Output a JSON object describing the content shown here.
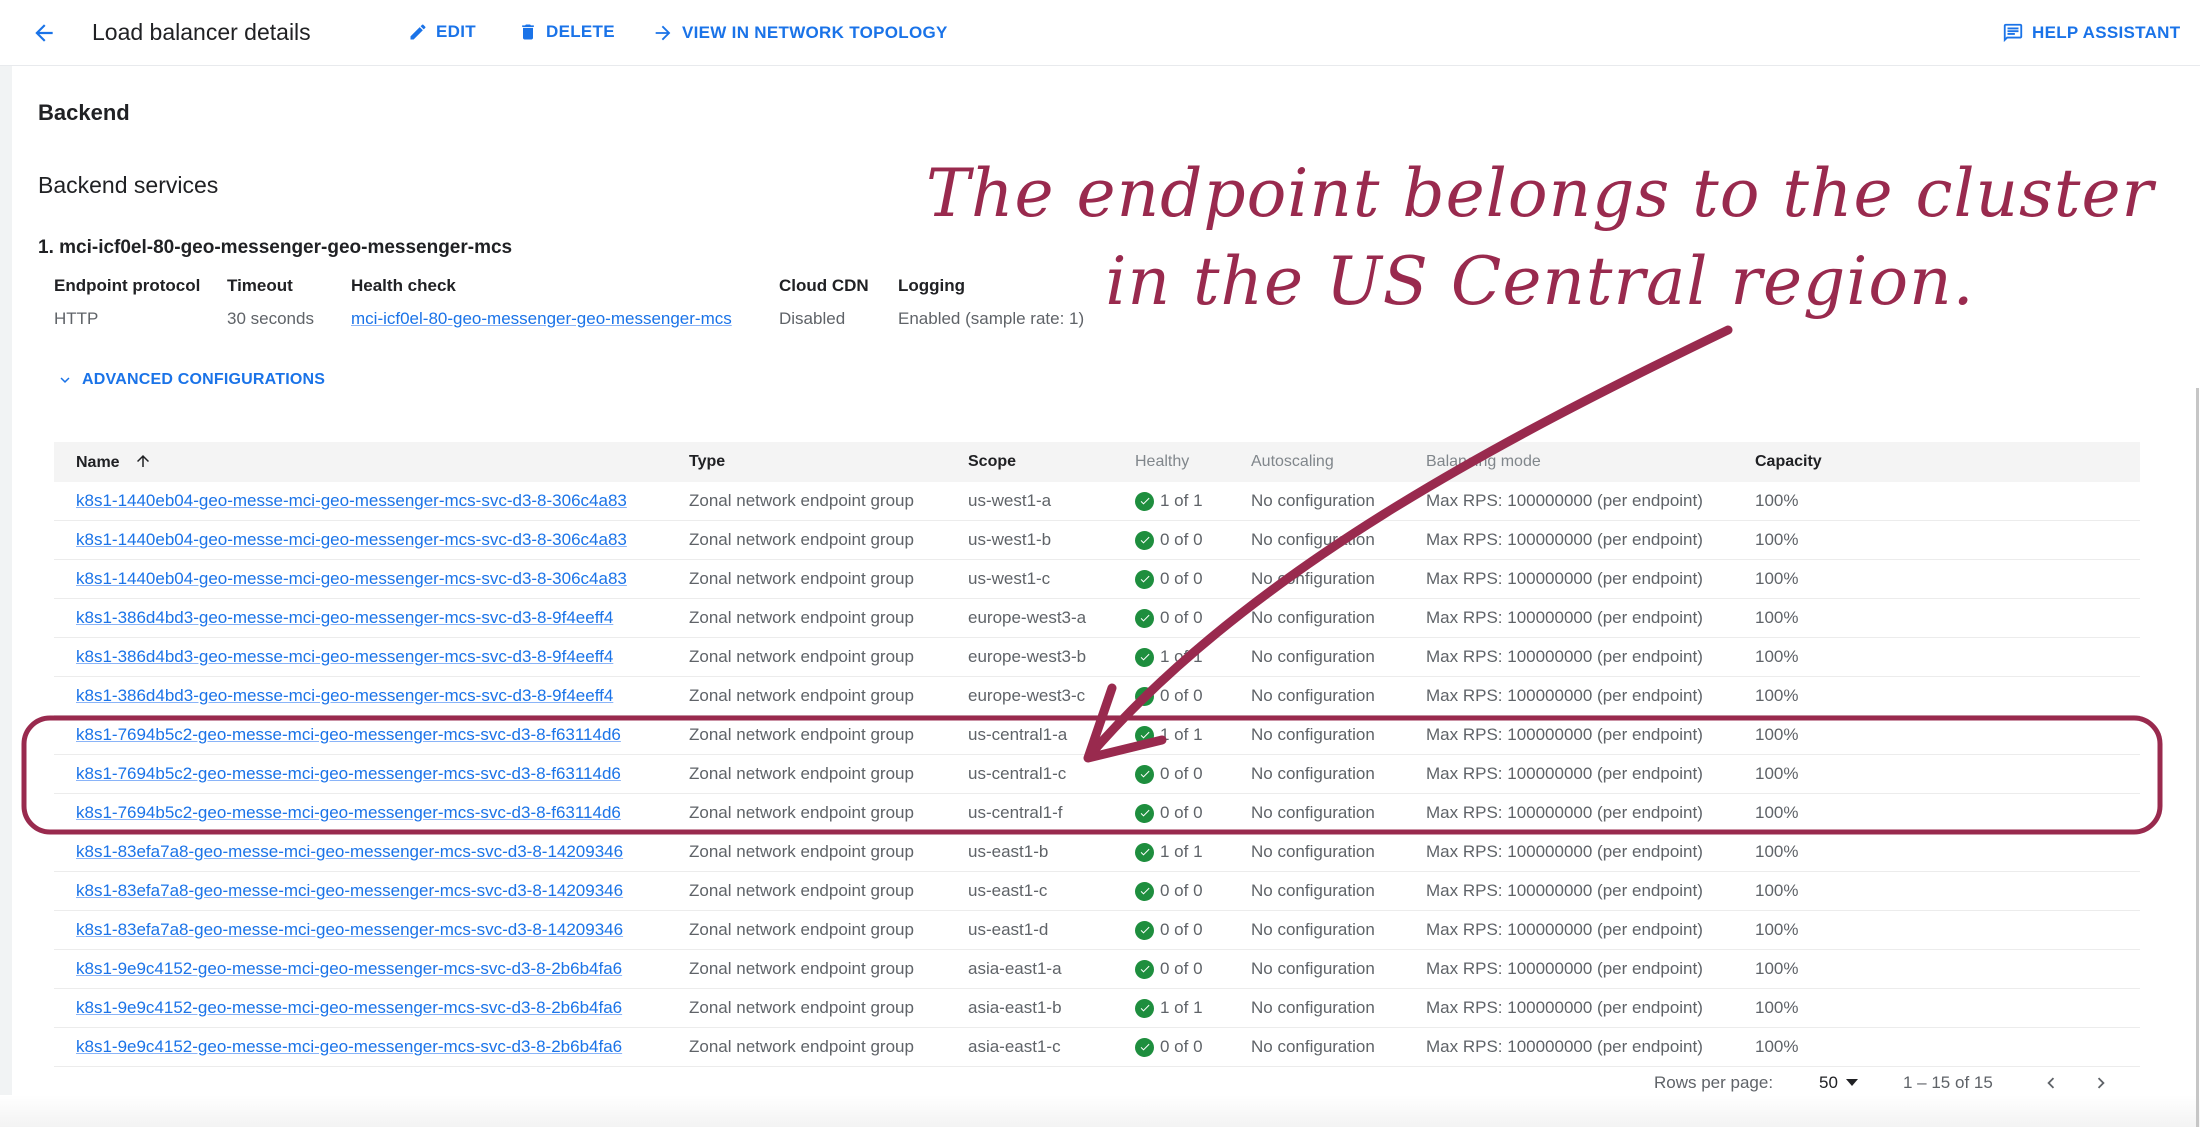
{
  "header": {
    "title": "Load balancer details",
    "actions": {
      "edit": "EDIT",
      "delete": "DELETE",
      "topology": "VIEW IN NETWORK TOPOLOGY",
      "help": "HELP ASSISTANT"
    }
  },
  "sections": {
    "backend": "Backend",
    "backend_services": "Backend services"
  },
  "service": {
    "name": "1. mci-icf0el-80-geo-messenger-geo-messenger-mcs",
    "properties": {
      "endpoint_protocol": {
        "label": "Endpoint protocol",
        "value": "HTTP"
      },
      "timeout": {
        "label": "Timeout",
        "value": "30 seconds"
      },
      "health_check": {
        "label": "Health check",
        "value": "mci-icf0el-80-geo-messenger-geo-messenger-mcs"
      },
      "cloud_cdn": {
        "label": "Cloud CDN",
        "value": "Disabled"
      },
      "logging": {
        "label": "Logging",
        "value": "Enabled (sample rate: 1)"
      }
    },
    "advanced_label": "ADVANCED CONFIGURATIONS"
  },
  "table": {
    "columns": {
      "name": "Name",
      "type": "Type",
      "scope": "Scope",
      "healthy": "Healthy",
      "autoscaling": "Autoscaling",
      "balancing": "Balancing mode",
      "capacity": "Capacity"
    },
    "sort": {
      "column": "name",
      "direction": "ascending"
    },
    "rows": [
      {
        "name": "k8s1-1440eb04-geo-messe-mci-geo-messenger-mcs-svc-d3-8-306c4a83",
        "type": "Zonal network endpoint group",
        "scope": "us-west1-a",
        "healthy": "1 of 1",
        "autoscaling": "No configuration",
        "balancing": "Max RPS: 100000000 (per endpoint)",
        "capacity": "100%"
      },
      {
        "name": "k8s1-1440eb04-geo-messe-mci-geo-messenger-mcs-svc-d3-8-306c4a83",
        "type": "Zonal network endpoint group",
        "scope": "us-west1-b",
        "healthy": "0 of 0",
        "autoscaling": "No configuration",
        "balancing": "Max RPS: 100000000 (per endpoint)",
        "capacity": "100%"
      },
      {
        "name": "k8s1-1440eb04-geo-messe-mci-geo-messenger-mcs-svc-d3-8-306c4a83",
        "type": "Zonal network endpoint group",
        "scope": "us-west1-c",
        "healthy": "0 of 0",
        "autoscaling": "No configuration",
        "balancing": "Max RPS: 100000000 (per endpoint)",
        "capacity": "100%"
      },
      {
        "name": "k8s1-386d4bd3-geo-messe-mci-geo-messenger-mcs-svc-d3-8-9f4eeff4",
        "type": "Zonal network endpoint group",
        "scope": "europe-west3-a",
        "healthy": "0 of 0",
        "autoscaling": "No configuration",
        "balancing": "Max RPS: 100000000 (per endpoint)",
        "capacity": "100%"
      },
      {
        "name": "k8s1-386d4bd3-geo-messe-mci-geo-messenger-mcs-svc-d3-8-9f4eeff4",
        "type": "Zonal network endpoint group",
        "scope": "europe-west3-b",
        "healthy": "1 of 1",
        "autoscaling": "No configuration",
        "balancing": "Max RPS: 100000000 (per endpoint)",
        "capacity": "100%"
      },
      {
        "name": "k8s1-386d4bd3-geo-messe-mci-geo-messenger-mcs-svc-d3-8-9f4eeff4",
        "type": "Zonal network endpoint group",
        "scope": "europe-west3-c",
        "healthy": "0 of 0",
        "autoscaling": "No configuration",
        "balancing": "Max RPS: 100000000 (per endpoint)",
        "capacity": "100%"
      },
      {
        "name": "k8s1-7694b5c2-geo-messe-mci-geo-messenger-mcs-svc-d3-8-f63114d6",
        "type": "Zonal network endpoint group",
        "scope": "us-central1-a",
        "healthy": "1 of 1",
        "autoscaling": "No configuration",
        "balancing": "Max RPS: 100000000 (per endpoint)",
        "capacity": "100%"
      },
      {
        "name": "k8s1-7694b5c2-geo-messe-mci-geo-messenger-mcs-svc-d3-8-f63114d6",
        "type": "Zonal network endpoint group",
        "scope": "us-central1-c",
        "healthy": "0 of 0",
        "autoscaling": "No configuration",
        "balancing": "Max RPS: 100000000 (per endpoint)",
        "capacity": "100%"
      },
      {
        "name": "k8s1-7694b5c2-geo-messe-mci-geo-messenger-mcs-svc-d3-8-f63114d6",
        "type": "Zonal network endpoint group",
        "scope": "us-central1-f",
        "healthy": "0 of 0",
        "autoscaling": "No configuration",
        "balancing": "Max RPS: 100000000 (per endpoint)",
        "capacity": "100%"
      },
      {
        "name": "k8s1-83efa7a8-geo-messe-mci-geo-messenger-mcs-svc-d3-8-14209346",
        "type": "Zonal network endpoint group",
        "scope": "us-east1-b",
        "healthy": "1 of 1",
        "autoscaling": "No configuration",
        "balancing": "Max RPS: 100000000 (per endpoint)",
        "capacity": "100%"
      },
      {
        "name": "k8s1-83efa7a8-geo-messe-mci-geo-messenger-mcs-svc-d3-8-14209346",
        "type": "Zonal network endpoint group",
        "scope": "us-east1-c",
        "healthy": "0 of 0",
        "autoscaling": "No configuration",
        "balancing": "Max RPS: 100000000 (per endpoint)",
        "capacity": "100%"
      },
      {
        "name": "k8s1-83efa7a8-geo-messe-mci-geo-messenger-mcs-svc-d3-8-14209346",
        "type": "Zonal network endpoint group",
        "scope": "us-east1-d",
        "healthy": "0 of 0",
        "autoscaling": "No configuration",
        "balancing": "Max RPS: 100000000 (per endpoint)",
        "capacity": "100%"
      },
      {
        "name": "k8s1-9e9c4152-geo-messe-mci-geo-messenger-mcs-svc-d3-8-2b6b4fa6",
        "type": "Zonal network endpoint group",
        "scope": "asia-east1-a",
        "healthy": "0 of 0",
        "autoscaling": "No configuration",
        "balancing": "Max RPS: 100000000 (per endpoint)",
        "capacity": "100%"
      },
      {
        "name": "k8s1-9e9c4152-geo-messe-mci-geo-messenger-mcs-svc-d3-8-2b6b4fa6",
        "type": "Zonal network endpoint group",
        "scope": "asia-east1-b",
        "healthy": "1 of 1",
        "autoscaling": "No configuration",
        "balancing": "Max RPS: 100000000 (per endpoint)",
        "capacity": "100%"
      },
      {
        "name": "k8s1-9e9c4152-geo-messe-mci-geo-messenger-mcs-svc-d3-8-2b6b4fa6",
        "type": "Zonal network endpoint group",
        "scope": "asia-east1-c",
        "healthy": "0 of 0",
        "autoscaling": "No configuration",
        "balancing": "Max RPS: 100000000 (per endpoint)",
        "capacity": "100%"
      }
    ]
  },
  "pagination": {
    "rows_per_page_label": "Rows per page:",
    "rows_per_page": "50",
    "range": "1 – 15 of 15"
  },
  "annotation": {
    "text": "The endpoint belongs to the cluster in the US Central region.",
    "highlighted_scopes": [
      "us-central1-a",
      "us-central1-c",
      "us-central1-f"
    ],
    "color": "#992a4e"
  },
  "colors": {
    "accent": "#1a73e8",
    "healthy": "#1e8e3e",
    "annotation": "#992a4e"
  }
}
